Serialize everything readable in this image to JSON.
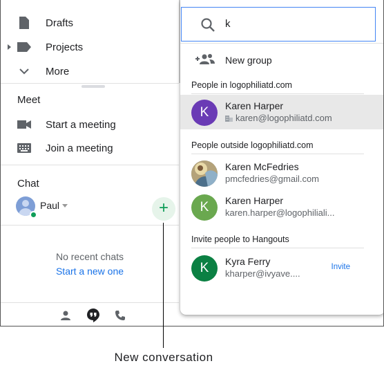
{
  "sidebar": {
    "items": [
      {
        "label": "Drafts",
        "icon": "drafts-icon"
      },
      {
        "label": "Projects",
        "icon": "label-icon"
      },
      {
        "label": "More",
        "icon": "chevron-down-icon"
      }
    ]
  },
  "meet": {
    "title": "Meet",
    "start_meeting": "Start a meeting",
    "join_meeting": "Join a meeting"
  },
  "chat": {
    "title": "Chat",
    "user_name": "Paul",
    "new_conversation_symbol": "+",
    "no_recent": "No recent chats",
    "start_new": "Start a new one"
  },
  "popup": {
    "search_value": "k",
    "new_group": "New group",
    "group_in": "People in logophiliatd.com",
    "group_outside": "People outside logophiliatd.com",
    "group_invite": "Invite people to Hangouts",
    "contacts_in": [
      {
        "initial": "K",
        "name": "Karen Harper",
        "email": "karen@logophiliatd.com",
        "color": "#6a3bb5"
      }
    ],
    "contacts_outside": [
      {
        "name": "Karen McFedries",
        "email": "pmcfedries@gmail.com"
      },
      {
        "initial": "K",
        "name": "Karen Harper",
        "email": "karen.harper@logophiliali...",
        "color": "#6aa84f"
      }
    ],
    "contacts_invite": [
      {
        "initial": "K",
        "name": "Kyra Ferry",
        "email": "kharper@ivyave....",
        "color": "#0b8043",
        "action": "Invite"
      }
    ]
  },
  "callout": {
    "label": "New conversation"
  },
  "colors": {
    "accent_blue": "#1a73e8",
    "green": "#0f9d58"
  }
}
